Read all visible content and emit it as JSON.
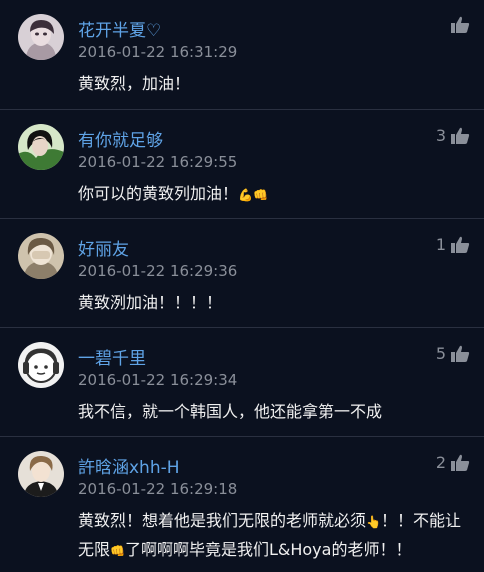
{
  "comments": [
    {
      "username": "花开半夏♡",
      "timestamp": "2016-01-22 16:31:29",
      "text": "黄致烈，加油！",
      "emojis": [],
      "like_count": "",
      "like_icon": "thumbs-up-icon",
      "avatar_color": "#c9b8c0"
    },
    {
      "username": "有你就足够",
      "timestamp": "2016-01-22 16:29:55",
      "text": "你可以的黄致列加油！",
      "emojis": [
        "💪",
        "👊"
      ],
      "like_count": "3",
      "like_icon": "thumbs-up-icon",
      "avatar_color": "#3a6a3a"
    },
    {
      "username": "好丽友",
      "timestamp": "2016-01-22 16:29:36",
      "text": "黄致洌加油！！！！",
      "emojis": [],
      "like_count": "1",
      "like_icon": "thumbs-up-icon",
      "avatar_color": "#b7a88f"
    },
    {
      "username": "一碧千里",
      "timestamp": "2016-01-22 16:29:34",
      "text": "我不信，就一个韩国人，他还能拿第一不成",
      "emojis": [],
      "like_count": "5",
      "like_icon": "thumbs-up-icon",
      "avatar_color": "#e8e8e8"
    },
    {
      "username": "許晗涵xhh-H",
      "timestamp": "2016-01-22 16:29:18",
      "text_part1": "黄致烈！想着他是我们无限的老师就必须",
      "emoji_a": "👆",
      "text_part2": "！！不能让无限",
      "emoji_b": "👊",
      "text_part3": "了啊啊啊毕竟是我们L&Hoya的老师！！",
      "like_count": "2",
      "like_icon": "thumbs-up-icon",
      "avatar_color": "#d9cfc6"
    }
  ],
  "colors": {
    "background": "#0b111f",
    "username": "#5fa3e6",
    "timestamp": "#8a8f99",
    "text": "#f0f0f0",
    "divider": "#2a3040"
  }
}
